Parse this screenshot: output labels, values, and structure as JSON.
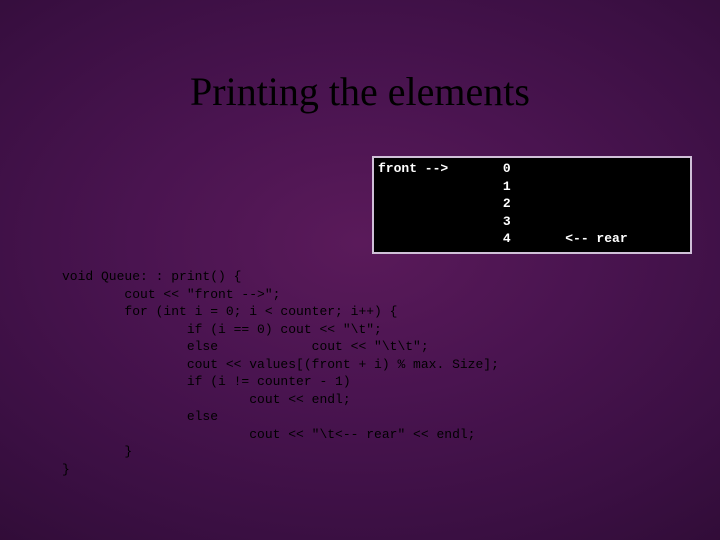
{
  "title": "Printing the elements",
  "output": "front -->       0\n                1\n                2\n                3\n                4       <-- rear",
  "code": "void Queue: : print() {\n        cout << \"front -->\";\n        for (int i = 0; i < counter; i++) {\n                if (i == 0) cout << \"\\t\";\n                else            cout << \"\\t\\t\";\n                cout << values[(front + i) % max. Size];\n                if (i != counter - 1)\n                        cout << endl;\n                else\n                        cout << \"\\t<-- rear\" << endl;\n        }\n}"
}
